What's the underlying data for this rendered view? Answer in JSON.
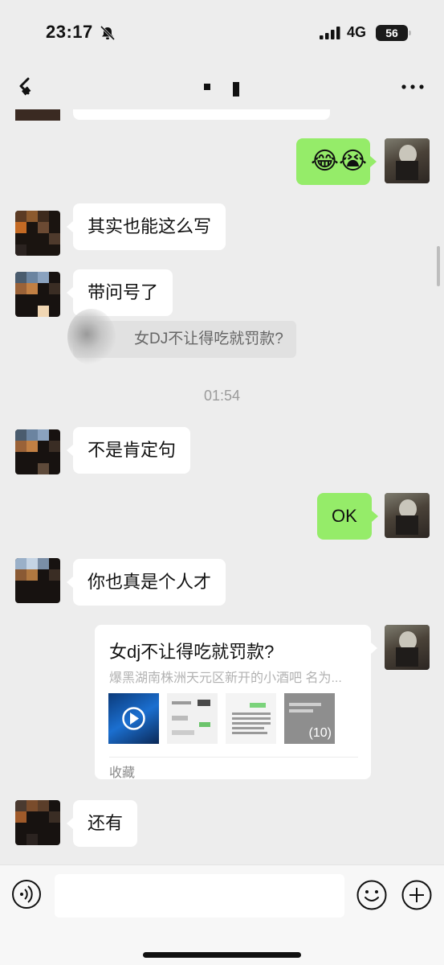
{
  "status_bar": {
    "time": "23:17",
    "network": "4G",
    "battery": "56",
    "icons": [
      "bell-muted-icon",
      "signal-icon",
      "battery-icon"
    ]
  },
  "nav": {
    "back_icon": "back-icon",
    "more_icon": "more-icon",
    "title_redacted": true
  },
  "messages": [
    {
      "side": "right",
      "type": "emoji",
      "text": "😂😭"
    },
    {
      "side": "left",
      "type": "text",
      "text": "其实也能这么写"
    },
    {
      "side": "left",
      "type": "text",
      "text": "带问号了"
    },
    {
      "side": "left",
      "type": "quote",
      "text": "女DJ不让得吃就罚款?"
    },
    {
      "type": "timestamp",
      "text": "01:54"
    },
    {
      "side": "left",
      "type": "text",
      "text": "不是肯定句"
    },
    {
      "side": "right",
      "type": "text",
      "text": "OK"
    },
    {
      "side": "left",
      "type": "text",
      "text": "你也真是个人才"
    },
    {
      "side": "right",
      "type": "card",
      "title": "女dj不让得吃就罚款?",
      "desc": "爆黑湖南株洲天元区新开的小酒吧  名为...",
      "thumb_count": "(10)",
      "source": "收藏"
    },
    {
      "side": "left",
      "type": "text",
      "text": "还有"
    }
  ],
  "input_bar": {
    "placeholder": "",
    "voice_icon": "voice-icon",
    "emoji_icon": "emoji-icon",
    "add_icon": "plus-icon"
  },
  "colors": {
    "background": "#ededed",
    "bubble_self": "#95ec69",
    "bubble_other": "#ffffff"
  }
}
